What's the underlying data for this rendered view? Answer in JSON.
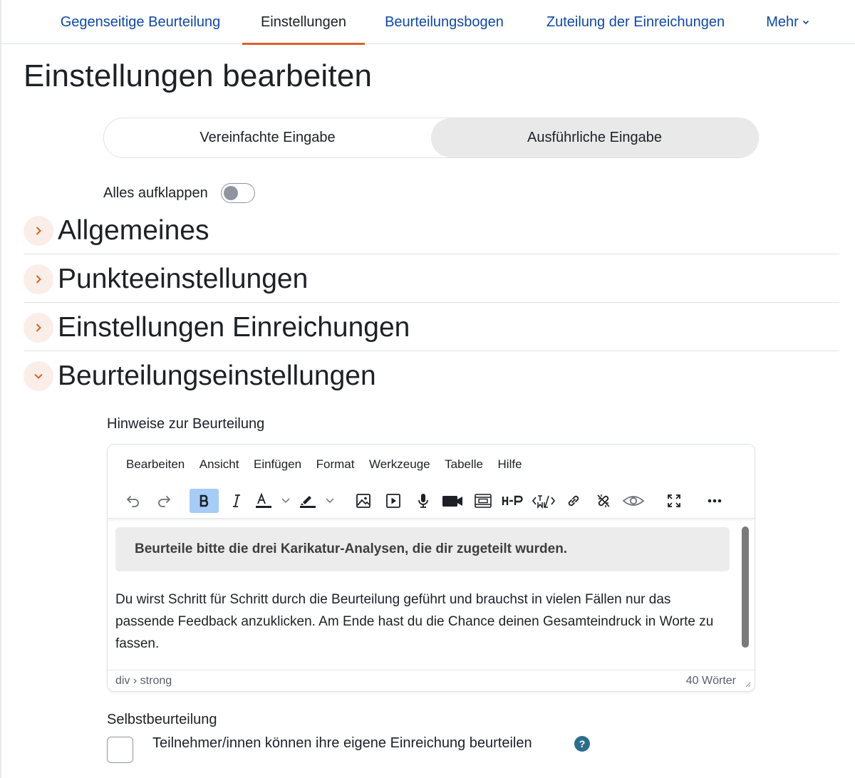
{
  "nav": {
    "tabs": [
      {
        "label": "Gegenseitige Beurteilung"
      },
      {
        "label": "Einstellungen"
      },
      {
        "label": "Beurteilungsbogen"
      },
      {
        "label": "Zuteilung der Einreichungen"
      },
      {
        "label": "Mehr"
      }
    ]
  },
  "page": {
    "title": "Einstellungen bearbeiten"
  },
  "mode": {
    "simple": "Vereinfachte Eingabe",
    "advanced": "Ausführliche Eingabe"
  },
  "expand_all": {
    "label": "Alles aufklappen"
  },
  "sections": [
    {
      "title": "Allgemeines"
    },
    {
      "title": "Punkteeinstellungen"
    },
    {
      "title": "Einstellungen Einreichungen"
    },
    {
      "title": "Beurteilungseinstellungen"
    }
  ],
  "assessment": {
    "instructions_label": "Hinweise zur Beurteilung",
    "editor": {
      "menu": [
        "Bearbeiten",
        "Ansicht",
        "Einfügen",
        "Format",
        "Werkzeuge",
        "Tabelle",
        "Hilfe"
      ],
      "callout": "Beurteile bitte die drei Karikatur-Analysen, die dir zugeteilt wurden.",
      "paragraph": "Du wirst Schritt für Schritt durch die Beurteilung geführt und brauchst in vielen Fällen nur das passende Feedback anzuklicken. Am Ende hast du die Chance deinen Gesamteindruck in Worte zu fassen.",
      "path": "div › strong",
      "word_count": "40 Wörter",
      "toolbar_icons": [
        "undo-icon",
        "redo-icon",
        "bold-icon",
        "italic-icon",
        "text-color-icon",
        "highlight-icon",
        "image-icon",
        "media-icon",
        "microphone-icon",
        "video-camera-icon",
        "embed-icon",
        "h5p-icon",
        "html-icon",
        "link-icon",
        "unlink-icon",
        "preview-icon",
        "fullscreen-icon",
        "more-icon"
      ]
    },
    "self_assessment_label": "Selbstbeurteilung",
    "self_assessment_checkbox": "Teilnehmer/innen können ihre eigene Einreichung beurteilen"
  },
  "colors": {
    "accent": "#d9622b",
    "link": "#0f47ad",
    "help_badge": "#2b6d8c"
  }
}
